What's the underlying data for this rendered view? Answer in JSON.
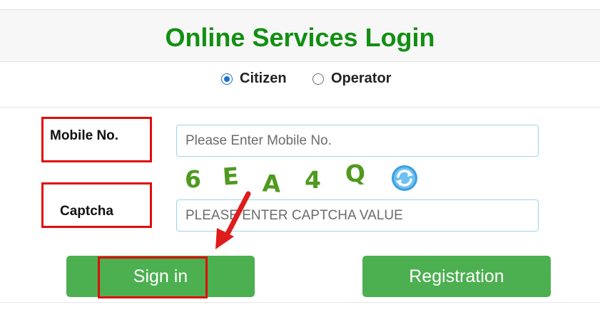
{
  "header": {
    "title": "Online Services Login"
  },
  "roles": [
    {
      "label": "Citizen",
      "selected": true
    },
    {
      "label": "Operator",
      "selected": false
    }
  ],
  "form": {
    "mobile": {
      "label": "Mobile No.",
      "placeholder": "Please Enter Mobile No.",
      "value": ""
    },
    "captcha_image": {
      "chars": [
        "6",
        "E",
        "A",
        "4",
        "Q"
      ]
    },
    "captcha": {
      "label": "Captcha",
      "placeholder": "PLEASE ENTER CAPTCHA VALUE",
      "value": ""
    }
  },
  "buttons": {
    "sign_in": "Sign in",
    "registration": "Registration"
  },
  "icons": {
    "refresh": "refresh-icon",
    "arrow": "arrow-pointer"
  },
  "colors": {
    "title": "#128f12",
    "button": "#4caf50",
    "highlight": "#e00d0d",
    "radio": "#1a6fd1"
  }
}
